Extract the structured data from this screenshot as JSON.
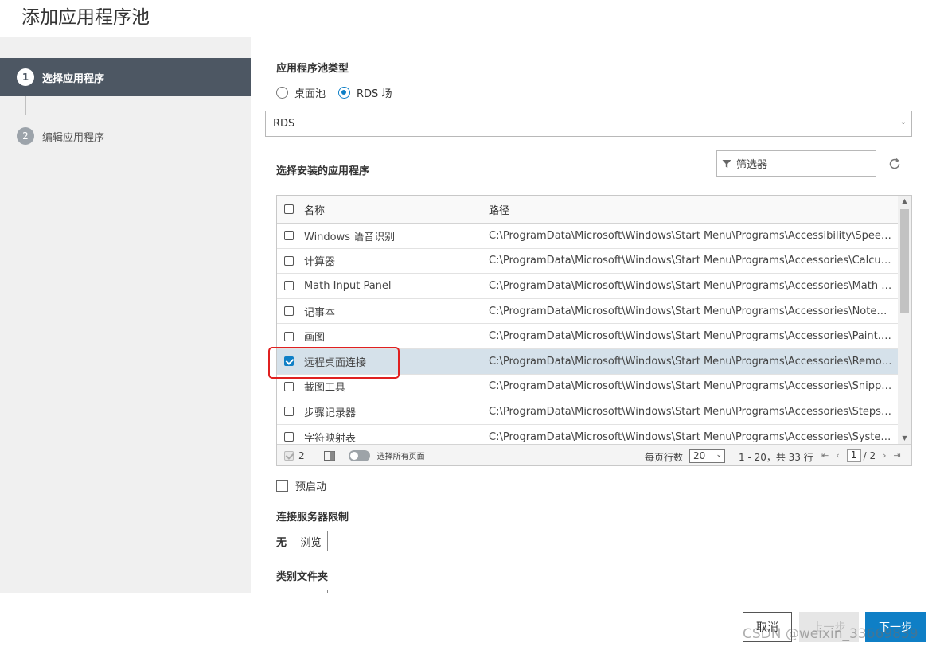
{
  "dialog": {
    "title": "添加应用程序池"
  },
  "wizard": {
    "steps": [
      {
        "num": "1",
        "label": "选择应用程序"
      },
      {
        "num": "2",
        "label": "编辑应用程序"
      }
    ]
  },
  "pool_type": {
    "label": "应用程序池类型",
    "options": [
      "桌面池",
      "RDS 场"
    ],
    "selected": "RDS 场"
  },
  "farm_select": {
    "value": "RDS"
  },
  "apps_section": {
    "label": "选择安装的应用程序"
  },
  "filter": {
    "placeholder": "筛选器"
  },
  "grid": {
    "columns": [
      "名称",
      "路径"
    ],
    "rows": [
      {
        "name": "Windows 语音识别",
        "path": "C:\\ProgramData\\Microsoft\\Windows\\Start Menu\\Programs\\Accessibility\\Speech R...",
        "checked": false
      },
      {
        "name": "计算器",
        "path": "C:\\ProgramData\\Microsoft\\Windows\\Start Menu\\Programs\\Accessories\\Calculator...",
        "checked": false
      },
      {
        "name": "Math Input Panel",
        "path": "C:\\ProgramData\\Microsoft\\Windows\\Start Menu\\Programs\\Accessories\\Math Inp...",
        "checked": false
      },
      {
        "name": "记事本",
        "path": "C:\\ProgramData\\Microsoft\\Windows\\Start Menu\\Programs\\Accessories\\Notepad.l...",
        "checked": false
      },
      {
        "name": "画图",
        "path": "C:\\ProgramData\\Microsoft\\Windows\\Start Menu\\Programs\\Accessories\\Paint.lnk",
        "checked": false
      },
      {
        "name": "远程桌面连接",
        "path": "C:\\ProgramData\\Microsoft\\Windows\\Start Menu\\Programs\\Accessories\\Remote D...",
        "checked": true
      },
      {
        "name": "截图工具",
        "path": "C:\\ProgramData\\Microsoft\\Windows\\Start Menu\\Programs\\Accessories\\Snipping ...",
        "checked": false
      },
      {
        "name": "步骤记录器",
        "path": "C:\\ProgramData\\Microsoft\\Windows\\Start Menu\\Programs\\Accessories\\Steps Rec...",
        "checked": false
      },
      {
        "name": "字符映射表",
        "path": "C:\\ProgramData\\Microsoft\\Windows\\Start Menu\\Programs\\Accessories\\System To...",
        "checked": false
      }
    ],
    "footer": {
      "selected_count": "2",
      "select_all_pages_label": "选择所有页面",
      "per_page_label": "每页行数",
      "per_page_value": "20",
      "range_text": "1 - 20，共 33 行",
      "current_page": "1",
      "total_pages": "/ 2"
    }
  },
  "prestart": {
    "label": "预启动"
  },
  "connection_limit": {
    "label": "连接服务器限制",
    "value": "无",
    "browse": "浏览"
  },
  "category_folder": {
    "label": "类别文件夹"
  },
  "buttons": {
    "cancel": "取消",
    "prev": "上一步",
    "next": "下一步"
  },
  "watermark": "CSDN @weixin_33669839",
  "colors": {
    "accent": "#0f7fc6",
    "sidebar_active": "#4d5763",
    "highlight": "#e02020"
  }
}
